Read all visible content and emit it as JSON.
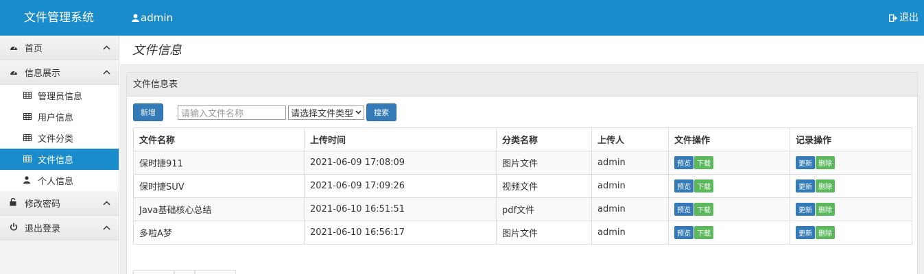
{
  "header": {
    "brand": "文件管理系统",
    "user": "admin",
    "logout": "退出"
  },
  "sidebar": {
    "groups": [
      {
        "label": "首页"
      },
      {
        "label": "信息展示",
        "items": [
          {
            "label": "管理员信息"
          },
          {
            "label": "用户信息"
          },
          {
            "label": "文件分类"
          },
          {
            "label": "文件信息",
            "active": true
          },
          {
            "label": "个人信息"
          }
        ]
      },
      {
        "label": "修改密码"
      },
      {
        "label": "退出登录"
      }
    ]
  },
  "main": {
    "page_title": "文件信息",
    "panel_title": "文件信息表",
    "add_button": "新增",
    "search_placeholder": "请输入文件名称",
    "type_select": "请选择文件类型",
    "search_button": "搜索",
    "columns": [
      "文件名称",
      "上传时间",
      "分类名称",
      "上传人",
      "文件操作",
      "记录操作"
    ],
    "rows": [
      {
        "name": "保时捷911",
        "time": "2021-06-09 17:08:09",
        "category": "图片文件",
        "uploader": "admin"
      },
      {
        "name": "保时捷SUV",
        "time": "2021-06-09 17:09:26",
        "category": "视频文件",
        "uploader": "admin"
      },
      {
        "name": "Java基础核心总结",
        "time": "2021-06-10 16:51:51",
        "category": "pdf文件",
        "uploader": "admin"
      },
      {
        "name": "多啦A梦",
        "time": "2021-06-10 16:56:17",
        "category": "图片文件",
        "uploader": "admin"
      }
    ],
    "actions": {
      "preview": "预览",
      "download": "下载",
      "update": "更新",
      "delete": "删除"
    }
  },
  "colors": {
    "brand_blue": "#1a8ccc",
    "button_blue": "#337ab7",
    "button_green": "#5cb85c"
  }
}
